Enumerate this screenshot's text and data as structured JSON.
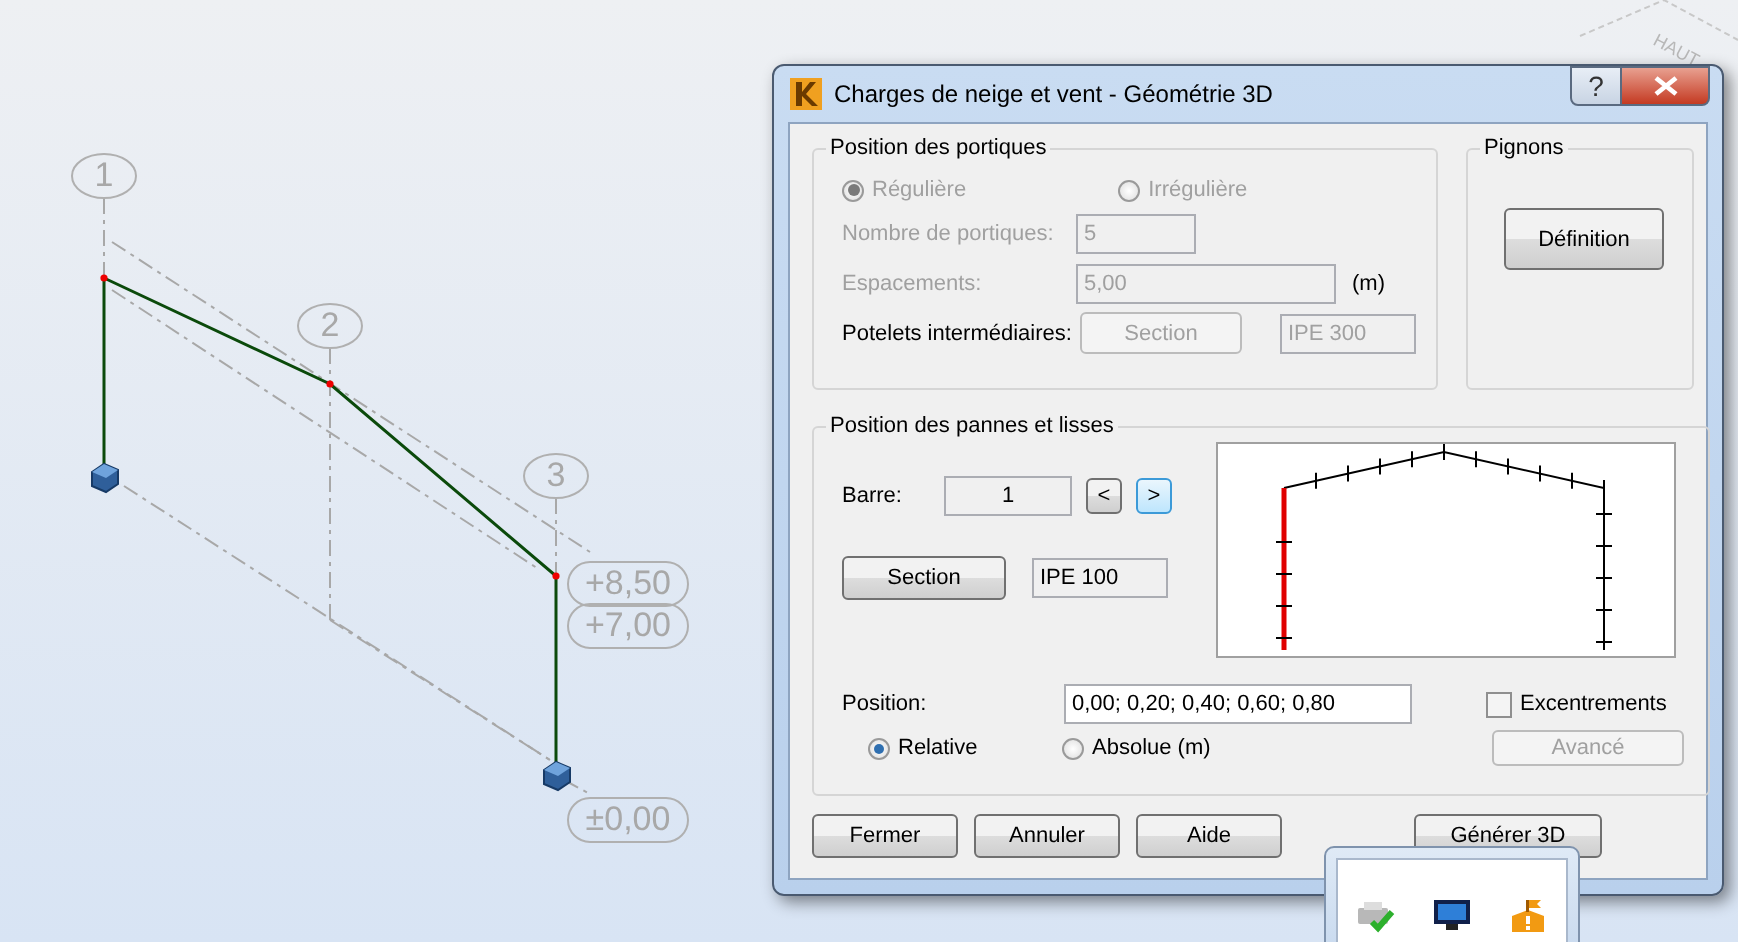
{
  "viewport": {
    "grid_labels": [
      "1",
      "2",
      "3"
    ],
    "levels": [
      "+8,50",
      "+7,00",
      "±0,00"
    ],
    "viewcube_label": "HAUT"
  },
  "window": {
    "title": "Charges de neige et vent - Géométrie 3D",
    "help_button": "?"
  },
  "frames_group": {
    "title": "Position des portiques",
    "disabled": true,
    "spacing_mode": [
      {
        "label": "Régulière",
        "selected": true
      },
      {
        "label": "Irrégulière",
        "selected": false
      }
    ],
    "count_label": "Nombre de portiques:",
    "count_value": "5",
    "spacing_label": "Espacements:",
    "spacing_value": "5,00",
    "spacing_unit": "(m)",
    "posts_label": "Potelets intermédiaires:",
    "posts_button": {
      "label": "Section",
      "disabled": true
    },
    "posts_section": "IPE 300"
  },
  "gables_group": {
    "title": "Pignons",
    "button": "Définition"
  },
  "purlins_group": {
    "title": "Position des pannes et lisses",
    "bar_label": "Barre:",
    "bar_value": "1",
    "prev_button": "<",
    "next_button": ">",
    "section_button": "Section",
    "section_value": "IPE 100",
    "position_label": "Position:",
    "position_value": "0,00; 0,20; 0,40; 0,60; 0,80",
    "position_mode": [
      {
        "label": "Relative",
        "selected": true
      },
      {
        "label": "Absolue (m)",
        "selected": false
      }
    ],
    "eccentricities": {
      "label": "Excentrements",
      "checked": false
    },
    "advanced_button": {
      "label": "Avancé",
      "disabled": true
    }
  },
  "buttons": [
    "Fermer",
    "Annuler",
    "Aide",
    "Générer 3D"
  ]
}
